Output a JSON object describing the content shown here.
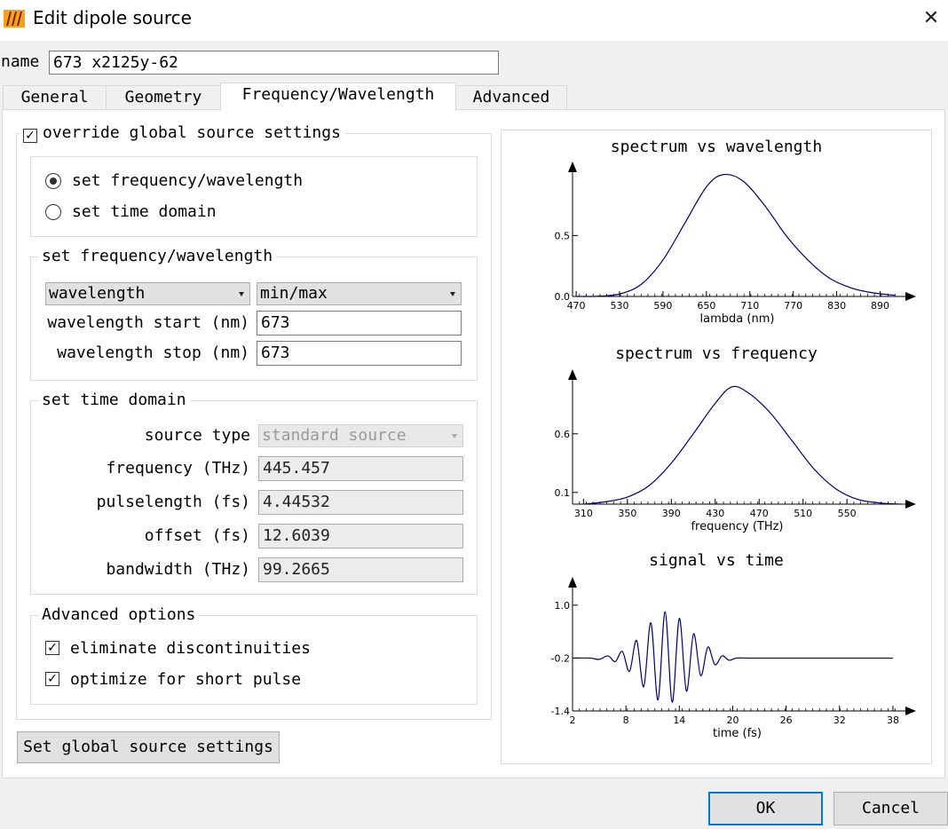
{
  "window": {
    "title": "Edit dipole source",
    "close_glyph": "✕"
  },
  "name_row": {
    "label": "name",
    "value": "673 x2125y-62"
  },
  "tabs": [
    {
      "label": "General"
    },
    {
      "label": "Geometry"
    },
    {
      "label": "Frequency/Wavelength"
    },
    {
      "label": "Advanced"
    }
  ],
  "override": {
    "label": "override global source settings",
    "checked": true
  },
  "mode": {
    "options": [
      {
        "label": "set frequency/wavelength",
        "selected": true
      },
      {
        "label": "set time domain",
        "selected": false
      }
    ]
  },
  "freq_group": {
    "title": "set frequency/wavelength",
    "combo1": "wavelength",
    "combo2": "min/max",
    "start_label": "wavelength start (nm)",
    "start_value": "673",
    "stop_label": "wavelength stop (nm)",
    "stop_value": "673"
  },
  "time_group": {
    "title": "set time domain",
    "source_type_label": "source type",
    "source_type_value": "standard source",
    "frequency_label": "frequency (THz)",
    "frequency_value": "445.457",
    "pulselength_label": "pulselength (fs)",
    "pulselength_value": "4.44532",
    "offset_label": "offset (fs)",
    "offset_value": "12.6039",
    "bandwidth_label": "bandwidth (THz)",
    "bandwidth_value": "99.2665"
  },
  "advanced_group": {
    "title": "Advanced options",
    "eliminate_label": "eliminate discontinuities",
    "eliminate_checked": true,
    "optimize_label": "optimize for short pulse",
    "optimize_checked": true
  },
  "buttons": {
    "global": "Set global source settings",
    "ok": "OK",
    "cancel": "Cancel"
  },
  "chart_data": [
    {
      "type": "line",
      "title": "spectrum vs wavelength",
      "xlabel": "lambda (nm)",
      "ylabel": "",
      "xlim": [
        465,
        920
      ],
      "ylim": [
        0,
        1.02
      ],
      "xticks": [
        "470",
        "530",
        "590",
        "650",
        "710",
        "770",
        "830",
        "890"
      ],
      "yticks": [
        "0.0",
        "0.5"
      ],
      "ytick_values": [
        0,
        0.5
      ],
      "x": [
        470,
        500,
        530,
        560,
        590,
        620,
        650,
        673,
        700,
        730,
        760,
        790,
        820,
        850,
        880,
        910
      ],
      "y": [
        0.0,
        0.002,
        0.02,
        0.1,
        0.3,
        0.6,
        0.9,
        1.0,
        0.95,
        0.75,
        0.5,
        0.3,
        0.15,
        0.07,
        0.03,
        0.01
      ]
    },
    {
      "type": "line",
      "title": "spectrum vs frequency",
      "xlabel": "frequency (THz)",
      "ylabel": "",
      "xlim": [
        300,
        600
      ],
      "ylim": [
        0,
        1.06
      ],
      "xticks": [
        "310",
        "350",
        "390",
        "430",
        "470",
        "510",
        "550"
      ],
      "yticks": [
        "0.1",
        "0.6"
      ],
      "ytick_values": [
        0.1,
        0.6
      ],
      "x": [
        310,
        330,
        350,
        370,
        390,
        410,
        430,
        445,
        460,
        480,
        500,
        520,
        540,
        560,
        580,
        600
      ],
      "y": [
        0.0,
        0.02,
        0.06,
        0.16,
        0.35,
        0.6,
        0.86,
        1.0,
        0.95,
        0.78,
        0.54,
        0.3,
        0.13,
        0.04,
        0.01,
        0.0
      ]
    },
    {
      "type": "line",
      "title": "signal vs time",
      "xlabel": "time (fs)",
      "ylabel": "",
      "xlim": [
        2,
        39
      ],
      "ylim": [
        -1.4,
        1.4
      ],
      "xticks": [
        "2",
        "8",
        "14",
        "20",
        "26",
        "32",
        "38"
      ],
      "yticks": [
        "1.0",
        "-0.2",
        "-1.4"
      ],
      "ytick_values": [
        1.0,
        -0.2,
        -1.4
      ],
      "x": [
        2,
        4,
        5,
        6,
        6.8,
        7.6,
        8.4,
        9.2,
        10,
        10.8,
        11.6,
        12.4,
        13.2,
        14,
        14.8,
        15.6,
        16.4,
        17.2,
        18,
        18.8,
        19.6,
        20.4,
        22,
        26,
        30,
        34,
        38
      ],
      "y": [
        -0.2,
        -0.2,
        -0.23,
        -0.15,
        -0.28,
        -0.05,
        -0.5,
        0.2,
        -0.85,
        0.6,
        -1.15,
        0.85,
        -1.2,
        0.7,
        -0.95,
        0.35,
        -0.6,
        0.05,
        -0.35,
        -0.15,
        -0.25,
        -0.2,
        -0.2,
        -0.2,
        -0.2,
        -0.2,
        -0.2
      ]
    }
  ]
}
